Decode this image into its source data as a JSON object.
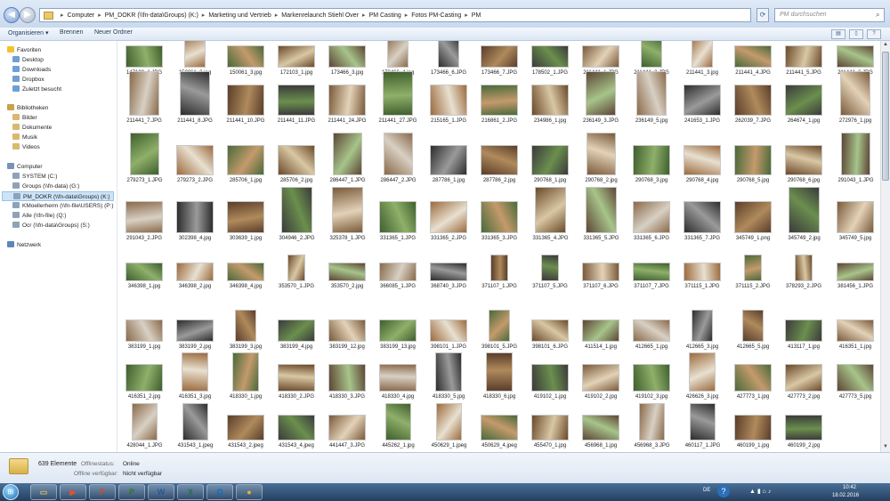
{
  "titlebar": {
    "breadcrumb": [
      "Computer",
      "PM_DOKR (\\\\fn-data\\Groups) (K:)",
      "Marketing und Vertrieb",
      "Markenrelaunch Stiehl Over",
      "PM Casting",
      "Fotos PM-Casting",
      "PM"
    ],
    "search_placeholder": "PM durchsuchen"
  },
  "toolbar": {
    "organize": "Organisieren ▾",
    "burn": "Brennen",
    "new_folder": "Neuer Ordner"
  },
  "sidebar": {
    "favorites_header": "Favoriten",
    "favorites": [
      "Desktop",
      "Downloads",
      "Dropbox",
      "Zuletzt besucht"
    ],
    "libraries_header": "Bibliotheken",
    "libraries": [
      "Bilder",
      "Dokumente",
      "Musik",
      "Videos"
    ],
    "computer_header": "Computer",
    "drives": [
      "SYSTEM (C:)",
      "Groups (\\\\fn-data) (G:)",
      "PM_DOKR (\\\\fn-data\\Groups) (K:)",
      "KMoellerherm (\\\\fn-file\\USERS) (P:)",
      "Alle (\\\\fn-file) (Q:)",
      "Ocr (\\\\fn-data\\Groups) (S:)"
    ],
    "selected_drive": "PM_DOKR (\\\\fn-data\\Groups) (K:)",
    "network_header": "Netzwerk"
  },
  "files": [
    "147188_1.JPG",
    "150061_2.jpg",
    "150061_3.jpg",
    "172103_1.jpg",
    "173466_3.jpg",
    "173466_4.jpg",
    "173466_6.JPG",
    "173466_7.JPG",
    "178502_1.JPG",
    "211441_1.JPG",
    "211441_2.JPG",
    "211441_3.jpg",
    "211441_4.JPG",
    "211441_5.JPG",
    "211441_6.JPG",
    "211441_7.JPG",
    "211441_8.JPG",
    "211441_10.JPG",
    "211441_11.JPG",
    "211441_24.JPG",
    "211441_27.JPG",
    "215165_1.JPG",
    "216861_2.JPG",
    "234986_1.jpg",
    "236149_3.JPG",
    "236149_5.jpg",
    "241653_1.JPG",
    "262039_7.JPG",
    "264674_1.jpg",
    "272976_1.jpg",
    "279273_1.JPG",
    "279273_2.JPG",
    "285706_1.jpg",
    "285706_2.jpg",
    "286447_1.JPG",
    "286447_2.JPG",
    "287786_1.jpg",
    "287786_2.jpg",
    "290768_1.jpg",
    "290768_2.jpg",
    "290768_3.jpg",
    "290768_4.jpg",
    "290768_5.jpg",
    "290768_6.jpg",
    "291043_1.JPG",
    "291043_2.JPG",
    "302398_4.jpg",
    "303639_1.jpg",
    "304946_2.JPG",
    "325378_1.JPG",
    "331365_1.JPG",
    "331365_2.JPG",
    "331365_3.JPG",
    "331365_4.JPG",
    "331365_5.JPG",
    "331365_6.JPG",
    "331365_7.JPG",
    "345749_1.png",
    "345749_2.jpg",
    "345749_5.jpg",
    "346398_1.jpg",
    "346398_2.jpg",
    "346398_4.jpg",
    "353570_1.JPG",
    "353570_2.jpg",
    "366085_1.JPG",
    "368740_3.JPG",
    "371107_1.JPG",
    "371107_5.JPG",
    "371107_6.JPG",
    "371107_7.JPG",
    "371115_1.JPG",
    "371115_2.JPG",
    "378293_2.JPG",
    "381456_1.JPG",
    "383199_1.jpg",
    "383199_2.jpg",
    "383199_3.jpg",
    "383199_4.jpg",
    "383199_12.jpg",
    "383199_13.jpg",
    "398101_1.JPG",
    "398101_5.JPG",
    "398101_6.JPG",
    "411514_1.jpg",
    "412665_1.jpg",
    "412665_3.jpg",
    "412665_5.jpg",
    "413117_1.jpg",
    "416351_1.jpg",
    "416351_2.jpg",
    "416351_3.jpg",
    "418330_1.jpg",
    "418330_2.JPG",
    "418330_3.JPG",
    "418330_4.jpg",
    "418330_5.jpg",
    "418330_6.jpg",
    "419102_1.jpg",
    "419102_2.jpg",
    "419102_3.jpg",
    "426626_3.jpg",
    "427773_1.jpg",
    "427773_2.jpg",
    "427773_5.jpg",
    "428044_1.JPG",
    "431543_1.jpeg",
    "431543_2.jpeg",
    "431543_4.jpeg",
    "441447_3.JPG",
    "445262_1.jpg",
    "450629_1.jpeg",
    "450629_4.jpeg",
    "455470_1.jpg",
    "456968_1.jpg",
    "456968_3.JPG",
    "460117_1.JPG",
    "460199_1.jpg",
    "460199_2.jpg"
  ],
  "details": {
    "count": "639 Elemente",
    "status_label": "Offlinestatus:",
    "status_value": "Online",
    "available_label": "Offline verfügbar:",
    "available_value": "Nicht verfügbar"
  },
  "taskbar": {
    "apps": [
      {
        "name": "explorer",
        "glyph": "▭",
        "color": "#d9b85a"
      },
      {
        "name": "media",
        "glyph": "▶",
        "color": "#e0542c"
      },
      {
        "name": "powerpoint",
        "glyph": "P",
        "color": "#d24726"
      },
      {
        "name": "project",
        "glyph": "P",
        "color": "#31752f"
      },
      {
        "name": "word",
        "glyph": "W",
        "color": "#2b579a"
      },
      {
        "name": "excel",
        "glyph": "X",
        "color": "#217346"
      },
      {
        "name": "outlook",
        "glyph": "O",
        "color": "#0072c6"
      },
      {
        "name": "chrome",
        "glyph": "●",
        "color": "#e8b32b"
      }
    ],
    "lang": "DE",
    "time": "10:42",
    "date": "18.02.2016"
  }
}
